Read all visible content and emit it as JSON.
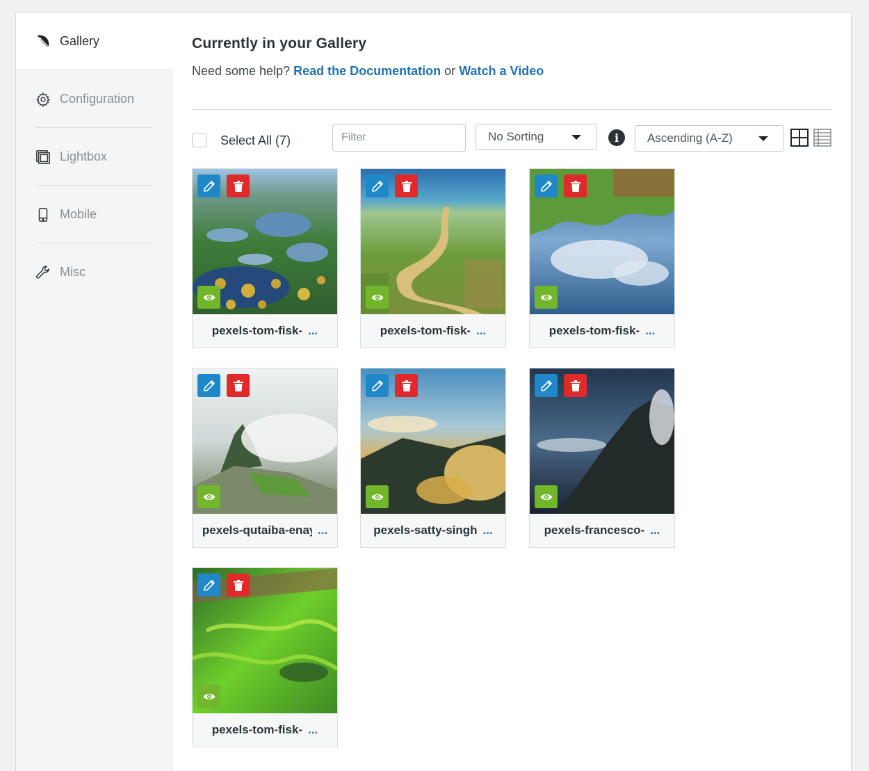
{
  "sidebar": {
    "items": [
      {
        "label": "Gallery",
        "icon": "leaf-icon",
        "active": true
      },
      {
        "label": "Configuration",
        "icon": "gear-icon",
        "active": false
      },
      {
        "label": "Lightbox",
        "icon": "gallery-frames-icon",
        "active": false
      },
      {
        "label": "Mobile",
        "icon": "mobile-phone-icon",
        "active": false
      },
      {
        "label": "Misc",
        "icon": "wrench-icon",
        "active": false
      }
    ]
  },
  "main": {
    "title": "Currently in your Gallery",
    "help_prefix": "Need some help?",
    "help_link1": "Read the Documentation",
    "help_or": "or",
    "help_link2": "Watch a Video"
  },
  "toolbar": {
    "select_all_label": "Select All (7)",
    "filter_placeholder": "Filter",
    "sorting_value": "No Sorting",
    "order_value": "Ascending (A-Z)",
    "view_icons": [
      "grid-view-icon",
      "list-view-icon"
    ]
  },
  "gallery": {
    "items": [
      {
        "caption": "pexels-tom-fisk-",
        "more": "..."
      },
      {
        "caption": "pexels-tom-fisk-",
        "more": "..."
      },
      {
        "caption": "pexels-tom-fisk-",
        "more": "..."
      },
      {
        "caption": "pexels-qutaiba-enay",
        "more": "..."
      },
      {
        "caption": "pexels-satty-singh",
        "more": "..."
      },
      {
        "caption": "pexels-francesco-",
        "more": "..."
      },
      {
        "caption": "pexels-tom-fisk-",
        "more": "..."
      }
    ]
  },
  "colors": {
    "edit": "#1e88c9",
    "delete": "#e02a2a",
    "view": "#71b62b",
    "link": "#2271b1"
  }
}
